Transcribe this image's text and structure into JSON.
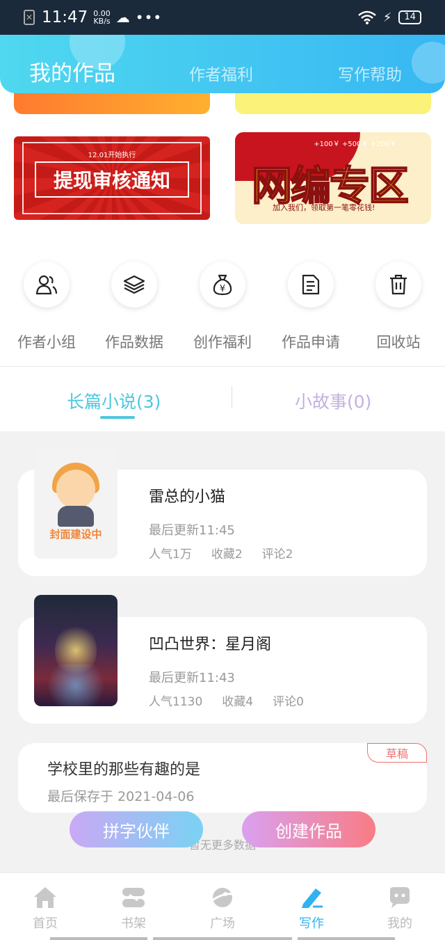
{
  "status_bar": {
    "time": "11:47",
    "speed_value": "0.00",
    "speed_unit": "KB/s",
    "dots": "•••",
    "battery": "14"
  },
  "header": {
    "title": "我的作品",
    "tabs": [
      "作者福利",
      "写作帮助"
    ]
  },
  "banners": {
    "notice_small": "12.01开始执行",
    "notice_title": "提现审核通知",
    "net_title": "网编专区",
    "net_sub": "加入我们，领取第一笔零花钱!",
    "net_bonus": "+100￥  +500￥  +200￥"
  },
  "quick_actions": [
    {
      "label": "作者小组",
      "icon": "user-group-icon"
    },
    {
      "label": "作品数据",
      "icon": "layers-icon"
    },
    {
      "label": "创作福利",
      "icon": "money-bag-icon"
    },
    {
      "label": "作品申请",
      "icon": "document-icon"
    },
    {
      "label": "回收站",
      "icon": "trash-icon"
    }
  ],
  "work_tabs": {
    "long": "长篇小说(3)",
    "short": "小故事(0)"
  },
  "works": [
    {
      "title": "雷总的小猫",
      "updated": "最后更新11:45",
      "popularity": "人气1万",
      "favorites": "收藏2",
      "comments": "评论2",
      "cover_label": "封面建设中"
    },
    {
      "title": "凹凸世界：星月阁",
      "updated": "最后更新11:43",
      "popularity": "人气1130",
      "favorites": "收藏4",
      "comments": "评论0"
    }
  ],
  "draft": {
    "title": "学校里的那些有趣的是",
    "saved": "最后保存于 2021-04-06",
    "badge": "草稿"
  },
  "no_more": "暂无更多数据",
  "floating_buttons": {
    "partner": "拼字伙伴",
    "create": "创建作品"
  },
  "bottom_nav": [
    {
      "label": "首页",
      "icon": "home-icon"
    },
    {
      "label": "书架",
      "icon": "bookshelf-icon"
    },
    {
      "label": "广场",
      "icon": "planet-icon"
    },
    {
      "label": "写作",
      "icon": "pen-icon",
      "active": true
    },
    {
      "label": "我的",
      "icon": "chat-profile-icon"
    }
  ],
  "colors": {
    "accent": "#2fb3f0",
    "tab_active": "#4cc7df",
    "draft_badge": "#f07070"
  }
}
